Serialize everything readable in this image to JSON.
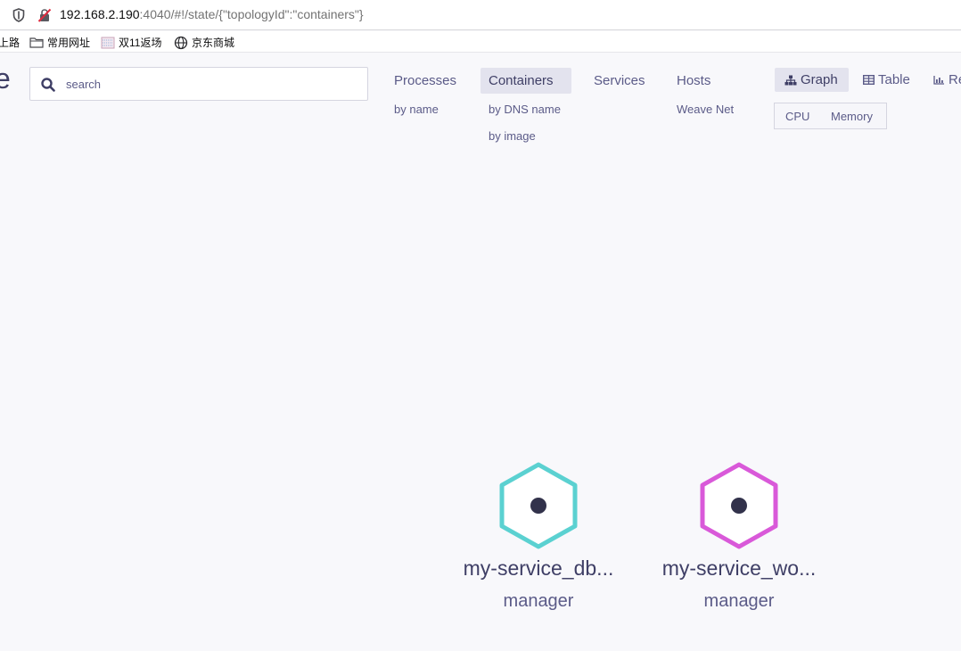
{
  "browser": {
    "url_host": "192.168.2.190",
    "url_rest": ":4040/#!/state/{\"topologyId\":\"containers\"}",
    "bookmarks": [
      {
        "label": "上路",
        "icon": "none"
      },
      {
        "label": "常用网址",
        "icon": "folder-icon"
      },
      {
        "label": "双11返场",
        "icon": "pattern-icon"
      },
      {
        "label": "京东商城",
        "icon": "globe-icon"
      }
    ]
  },
  "app": {
    "logo_fragment": "e",
    "search": {
      "placeholder": "search",
      "value": ""
    },
    "topologies": [
      {
        "label": "Processes",
        "sub": [
          "by name"
        ]
      },
      {
        "label": "Containers",
        "sub": [
          "by DNS name",
          "by image"
        ],
        "active": true
      },
      {
        "label": "Services",
        "sub": []
      },
      {
        "label": "Hosts",
        "sub": [
          "Weave Net"
        ]
      }
    ],
    "views": [
      {
        "label": "Graph",
        "icon": "graph-icon",
        "active": true
      },
      {
        "label": "Table",
        "icon": "table-icon"
      },
      {
        "label": "Re",
        "icon": "chart-icon"
      }
    ],
    "metrics": [
      "CPU",
      "Memory"
    ],
    "nodes": [
      {
        "label": "my-service_db...",
        "sublabel": "manager",
        "color": "#5bd1d1"
      },
      {
        "label": "my-service_wo...",
        "sublabel": "manager",
        "color": "#d959d9"
      }
    ]
  }
}
